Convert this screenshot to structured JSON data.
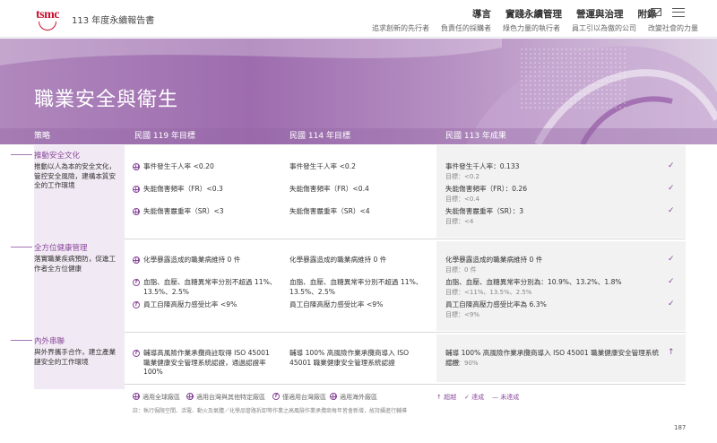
{
  "header": {
    "logo": "tsmc",
    "report_title": "113 年度永續報告書",
    "nav": [
      "導言",
      "實踐永續管理",
      "營運與治理",
      "附錄"
    ],
    "subnav": [
      "追求創新的先行者",
      "負責任的採購者",
      "綠色力量的執行者",
      "員工引以為傲的公司",
      "改變社會的力量"
    ],
    "mail_icon": "mail-icon",
    "menu_icon": "menu-icon"
  },
  "page_heading": "職業安全與衛生",
  "columns": {
    "strategy": "策略",
    "target_2030": "民國 119 年目標",
    "target_2025": "民國 114 年目標",
    "result_2024": "民國 113 年成果"
  },
  "sections": [
    {
      "title": "推動安全文化",
      "desc": "推動以人為本的安全文化，管控安全風險，建構本質安全的工作環境",
      "rows": [
        {
          "icon": "globe-icon",
          "t119": "事件發生千人率 <0.20",
          "t114": "事件發生千人率 <0.2",
          "result": "事件發生千人率：0.133",
          "goal": "目標：<0.2",
          "status": "✓"
        },
        {
          "icon": "letter-icon",
          "t119": "失能傷害頻率（FR）<0.3",
          "t114": "失能傷害頻率（FR）<0.4",
          "result": "失能傷害頻率（FR）：0.26",
          "goal": "目標：<0.4",
          "status": "✓"
        },
        {
          "icon": "globe-icon",
          "t119": "失能傷害嚴重率（SR）<3",
          "t114": "失能傷害嚴重率（SR）<4",
          "result": "失能傷害嚴重率（SR）：3",
          "goal": "目標：<4",
          "status": "✓"
        }
      ]
    },
    {
      "title": "全方位健康管理",
      "desc": "落實職業疾病預防，促進工作者全方位健康",
      "rows": [
        {
          "icon": "globe-icon",
          "t119": "化學暴露造成的職業病維持 0 件",
          "t114": "化學暴露造成的職業病維持 0 件",
          "result": "化學暴露造成的職業病維持 0 件",
          "goal": "目標：0 件",
          "status": "✓"
        },
        {
          "icon": "letter-icon",
          "t119": "血脂、血壓、血糖異常率分別不超過 11%、13.5%、2.5%",
          "t114": "血脂、血壓、血糖異常率分別不超過 11%、13.5%、2.5%",
          "result": "血脂、血壓、血糖異常率分別為：10.9%、13.2%、1.8%",
          "goal": "目標：<11%、13.5%、2.5%",
          "status": "✓"
        },
        {
          "icon": "letter-icon",
          "t119": "員工自陳高壓力感受比率 <9%",
          "t114": "員工自陳高壓力感受比率 <9%",
          "result": "員工自陳高壓力感受比率為 6.3%",
          "goal": "目標：<9%",
          "status": "✓"
        }
      ]
    },
    {
      "title": "內外串聯",
      "desc": "與外界攜手合作，建立產業鏈安全的工作環境",
      "rows": [
        {
          "icon": "letter-icon",
          "t119": "輔導高風險作業承攬商註取得 ISO 45001 職業健康安全管理系統認證，通過認證率 100%",
          "t114": "輔導 100% 高風險作業承攬商導入 ISO 45001 職業健康安全管理系統認證",
          "result": "輔導 100% 高風險作業承攬商導入 ISO 45001 職業健康安全管理系統認證",
          "goal": "目標：90%",
          "status": "↑"
        }
      ]
    }
  ],
  "legend": {
    "items": [
      "適用全球廠區",
      "適用台灣與其他特定廠區",
      "僅適用台灣廠區",
      "適用海外廠區"
    ],
    "status": [
      "↑ 超越",
      "✓ 達成",
      "— 未達成"
    ]
  },
  "note": "註：執行侷限空間、活電、動火及氣體／化學品管路拆卸等作業之高風險作業承攬商每年皆會新增，故持續進行輔導",
  "page_number": "187",
  "colors": {
    "accent": "#8a4a9c",
    "banner": "#9d6cae"
  }
}
